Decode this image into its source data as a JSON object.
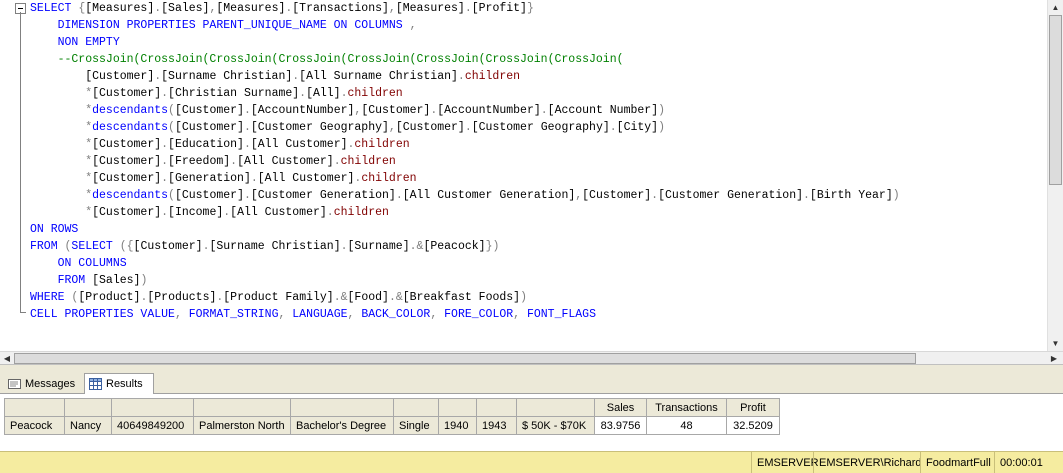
{
  "editor": {
    "lines": [
      [
        {
          "t": "SELECT ",
          "c": "kw"
        },
        {
          "t": "{",
          "c": "gr"
        },
        {
          "t": "[Measures]",
          "c": ""
        },
        {
          "t": ".",
          "c": "gr"
        },
        {
          "t": "[Sales]",
          "c": ""
        },
        {
          "t": ",",
          "c": "gr"
        },
        {
          "t": "[Measures]",
          "c": ""
        },
        {
          "t": ".",
          "c": "gr"
        },
        {
          "t": "[Transactions]",
          "c": ""
        },
        {
          "t": ",",
          "c": "gr"
        },
        {
          "t": "[Measures]",
          "c": ""
        },
        {
          "t": ".",
          "c": "gr"
        },
        {
          "t": "[Profit]",
          "c": ""
        },
        {
          "t": "}",
          "c": "gr"
        }
      ],
      [
        {
          "t": "    DIMENSION PROPERTIES PARENT_UNIQUE_NAME ON COLUMNS ",
          "c": "kw"
        },
        {
          "t": ",",
          "c": "gr"
        }
      ],
      [
        {
          "t": "    NON EMPTY",
          "c": "kw"
        }
      ],
      [
        {
          "t": "    --CrossJoin(CrossJoin(CrossJoin(CrossJoin(CrossJoin(CrossJoin(CrossJoin(CrossJoin(",
          "c": "cm"
        }
      ],
      [
        {
          "t": "        [Customer]",
          "c": ""
        },
        {
          "t": ".",
          "c": "gr"
        },
        {
          "t": "[Surname Christian]",
          "c": ""
        },
        {
          "t": ".",
          "c": "gr"
        },
        {
          "t": "[All Surname Christian]",
          "c": ""
        },
        {
          "t": ".",
          "c": "gr"
        },
        {
          "t": "children",
          "c": "ch"
        }
      ],
      [
        {
          "t": "        ",
          "c": ""
        },
        {
          "t": "*",
          "c": "gr"
        },
        {
          "t": "[Customer]",
          "c": ""
        },
        {
          "t": ".",
          "c": "gr"
        },
        {
          "t": "[Christian Surname]",
          "c": ""
        },
        {
          "t": ".",
          "c": "gr"
        },
        {
          "t": "[All]",
          "c": ""
        },
        {
          "t": ".",
          "c": "gr"
        },
        {
          "t": "children",
          "c": "ch"
        }
      ],
      [
        {
          "t": "        ",
          "c": ""
        },
        {
          "t": "*",
          "c": "gr"
        },
        {
          "t": "descendants",
          "c": "fn"
        },
        {
          "t": "(",
          "c": "gr"
        },
        {
          "t": "[Customer]",
          "c": ""
        },
        {
          "t": ".",
          "c": "gr"
        },
        {
          "t": "[AccountNumber]",
          "c": ""
        },
        {
          "t": ",",
          "c": "gr"
        },
        {
          "t": "[Customer]",
          "c": ""
        },
        {
          "t": ".",
          "c": "gr"
        },
        {
          "t": "[AccountNumber]",
          "c": ""
        },
        {
          "t": ".",
          "c": "gr"
        },
        {
          "t": "[Account Number]",
          "c": ""
        },
        {
          "t": ")",
          "c": "gr"
        }
      ],
      [
        {
          "t": "        ",
          "c": ""
        },
        {
          "t": "*",
          "c": "gr"
        },
        {
          "t": "descendants",
          "c": "fn"
        },
        {
          "t": "(",
          "c": "gr"
        },
        {
          "t": "[Customer]",
          "c": ""
        },
        {
          "t": ".",
          "c": "gr"
        },
        {
          "t": "[Customer Geography]",
          "c": ""
        },
        {
          "t": ",",
          "c": "gr"
        },
        {
          "t": "[Customer]",
          "c": ""
        },
        {
          "t": ".",
          "c": "gr"
        },
        {
          "t": "[Customer Geography]",
          "c": ""
        },
        {
          "t": ".",
          "c": "gr"
        },
        {
          "t": "[City]",
          "c": ""
        },
        {
          "t": ")",
          "c": "gr"
        }
      ],
      [
        {
          "t": "        ",
          "c": ""
        },
        {
          "t": "*",
          "c": "gr"
        },
        {
          "t": "[Customer]",
          "c": ""
        },
        {
          "t": ".",
          "c": "gr"
        },
        {
          "t": "[Education]",
          "c": ""
        },
        {
          "t": ".",
          "c": "gr"
        },
        {
          "t": "[All Customer]",
          "c": ""
        },
        {
          "t": ".",
          "c": "gr"
        },
        {
          "t": "children",
          "c": "ch"
        }
      ],
      [
        {
          "t": "        ",
          "c": ""
        },
        {
          "t": "*",
          "c": "gr"
        },
        {
          "t": "[Customer]",
          "c": ""
        },
        {
          "t": ".",
          "c": "gr"
        },
        {
          "t": "[Freedom]",
          "c": ""
        },
        {
          "t": ".",
          "c": "gr"
        },
        {
          "t": "[All Customer]",
          "c": ""
        },
        {
          "t": ".",
          "c": "gr"
        },
        {
          "t": "children",
          "c": "ch"
        }
      ],
      [
        {
          "t": "        ",
          "c": ""
        },
        {
          "t": "*",
          "c": "gr"
        },
        {
          "t": "[Customer]",
          "c": ""
        },
        {
          "t": ".",
          "c": "gr"
        },
        {
          "t": "[Generation]",
          "c": ""
        },
        {
          "t": ".",
          "c": "gr"
        },
        {
          "t": "[All Customer]",
          "c": ""
        },
        {
          "t": ".",
          "c": "gr"
        },
        {
          "t": "children",
          "c": "ch"
        }
      ],
      [
        {
          "t": "        ",
          "c": ""
        },
        {
          "t": "*",
          "c": "gr"
        },
        {
          "t": "descendants",
          "c": "fn"
        },
        {
          "t": "(",
          "c": "gr"
        },
        {
          "t": "[Customer]",
          "c": ""
        },
        {
          "t": ".",
          "c": "gr"
        },
        {
          "t": "[Customer Generation]",
          "c": ""
        },
        {
          "t": ".",
          "c": "gr"
        },
        {
          "t": "[All Customer Generation]",
          "c": ""
        },
        {
          "t": ",",
          "c": "gr"
        },
        {
          "t": "[Customer]",
          "c": ""
        },
        {
          "t": ".",
          "c": "gr"
        },
        {
          "t": "[Customer Generation]",
          "c": ""
        },
        {
          "t": ".",
          "c": "gr"
        },
        {
          "t": "[Birth Year]",
          "c": ""
        },
        {
          "t": ")",
          "c": "gr"
        }
      ],
      [
        {
          "t": "        ",
          "c": ""
        },
        {
          "t": "*",
          "c": "gr"
        },
        {
          "t": "[Customer]",
          "c": ""
        },
        {
          "t": ".",
          "c": "gr"
        },
        {
          "t": "[Income]",
          "c": ""
        },
        {
          "t": ".",
          "c": "gr"
        },
        {
          "t": "[All Customer]",
          "c": ""
        },
        {
          "t": ".",
          "c": "gr"
        },
        {
          "t": "children",
          "c": "ch"
        }
      ],
      [
        {
          "t": "ON ROWS",
          "c": "kw"
        }
      ],
      [
        {
          "t": "FROM ",
          "c": "kw"
        },
        {
          "t": "(",
          "c": "gr"
        },
        {
          "t": "SELECT ",
          "c": "kw"
        },
        {
          "t": "({",
          "c": "gr"
        },
        {
          "t": "[Customer]",
          "c": ""
        },
        {
          "t": ".",
          "c": "gr"
        },
        {
          "t": "[Surname Christian]",
          "c": ""
        },
        {
          "t": ".",
          "c": "gr"
        },
        {
          "t": "[Surname]",
          "c": ""
        },
        {
          "t": ".&",
          "c": "gr"
        },
        {
          "t": "[Peacock]",
          "c": ""
        },
        {
          "t": "})",
          "c": "gr"
        }
      ],
      [
        {
          "t": "    ON COLUMNS",
          "c": "kw"
        }
      ],
      [
        {
          "t": "    FROM ",
          "c": "kw"
        },
        {
          "t": "[Sales]",
          "c": ""
        },
        {
          "t": ")",
          "c": "gr"
        }
      ],
      [
        {
          "t": "WHERE ",
          "c": "kw"
        },
        {
          "t": "(",
          "c": "gr"
        },
        {
          "t": "[Product]",
          "c": ""
        },
        {
          "t": ".",
          "c": "gr"
        },
        {
          "t": "[Products]",
          "c": ""
        },
        {
          "t": ".",
          "c": "gr"
        },
        {
          "t": "[Product Family]",
          "c": ""
        },
        {
          "t": ".&",
          "c": "gr"
        },
        {
          "t": "[Food]",
          "c": ""
        },
        {
          "t": ".&",
          "c": "gr"
        },
        {
          "t": "[Breakfast Foods]",
          "c": ""
        },
        {
          "t": ")",
          "c": "gr"
        }
      ],
      [
        {
          "t": "CELL PROPERTIES VALUE",
          "c": "kw"
        },
        {
          "t": ", ",
          "c": "gr"
        },
        {
          "t": "FORMAT_STRING",
          "c": "kw"
        },
        {
          "t": ", ",
          "c": "gr"
        },
        {
          "t": "LANGUAGE",
          "c": "kw"
        },
        {
          "t": ", ",
          "c": "gr"
        },
        {
          "t": "BACK_COLOR",
          "c": "kw"
        },
        {
          "t": ", ",
          "c": "gr"
        },
        {
          "t": "FORE_COLOR",
          "c": "kw"
        },
        {
          "t": ", ",
          "c": "gr"
        },
        {
          "t": "FONT_FLAGS",
          "c": "kw"
        }
      ]
    ]
  },
  "tabs": {
    "messages": "Messages",
    "results": "Results"
  },
  "results": {
    "headers": [
      "",
      "",
      "",
      "",
      "",
      "",
      "",
      "",
      "",
      "Sales",
      "Transactions",
      "Profit"
    ],
    "rows": [
      [
        "Peacock",
        "Nancy",
        "40649849200",
        "Palmerston North",
        "Bachelor's Degree",
        "Single",
        "1940",
        "1943",
        "$ 50K - $70K",
        "83.9756",
        "48",
        "32.5209"
      ]
    ]
  },
  "status": {
    "server": "EMSERVER",
    "user": "EMSERVER\\Richard",
    "database": "FoodmartFull",
    "elapsed": "00:00:01"
  },
  "colors": {
    "keyword": "#0000ff",
    "comment": "#008000",
    "operator": "#808080",
    "member_function": "#800000",
    "status_bar": "#f5eca0"
  }
}
